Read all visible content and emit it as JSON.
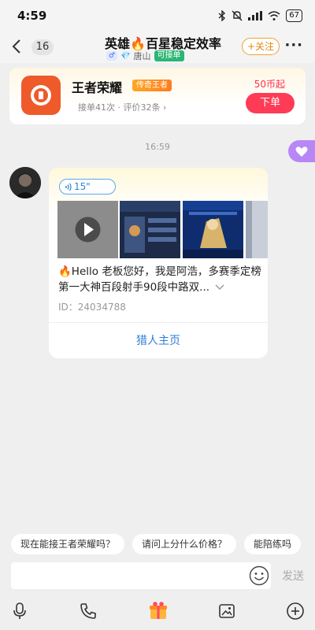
{
  "status": {
    "time": "4:59",
    "battery": "67",
    "network": "4G"
  },
  "header": {
    "unread_count": "16",
    "title": "英雄🔥百星稳定效率",
    "gender_symbol": "♂",
    "gem_icon": "💎",
    "city": "唐山",
    "can_order": "可接单",
    "follow_label": "+关注",
    "more": "···"
  },
  "game_card": {
    "name": "王者荣耀",
    "rank": "传奇王者",
    "orders": "接单41次",
    "separator": "·",
    "reviews": "评价32条",
    "arrow": "›",
    "price": "50币起",
    "order_button": "下单",
    "icon_color": "#ef5a2b"
  },
  "chat": {
    "timestamp": "16:59",
    "voice_duration": "15\"",
    "intro_text": "🔥Hello 老板您好，我是阿浩，多赛季定榜第一大神百段射手90段中路双...",
    "expand_icon": "chevron-down-icon",
    "uid": "ID：24034788",
    "home_link": "猎人主页"
  },
  "quick_replies": [
    "现在能接王者荣耀吗？",
    "请问上分什么价格？",
    "能陪练吗"
  ],
  "input": {
    "placeholder": "",
    "send_label": "发送"
  },
  "toolbar": {
    "icons": [
      "microphone-icon",
      "phone-icon",
      "gift-icon",
      "image-icon",
      "plus-icon"
    ]
  },
  "colors": {
    "accent_red": "#ff3b55",
    "link_blue": "#2e7fd8",
    "follow_orange": "#e08a12",
    "badge_green": "#2bb673"
  }
}
